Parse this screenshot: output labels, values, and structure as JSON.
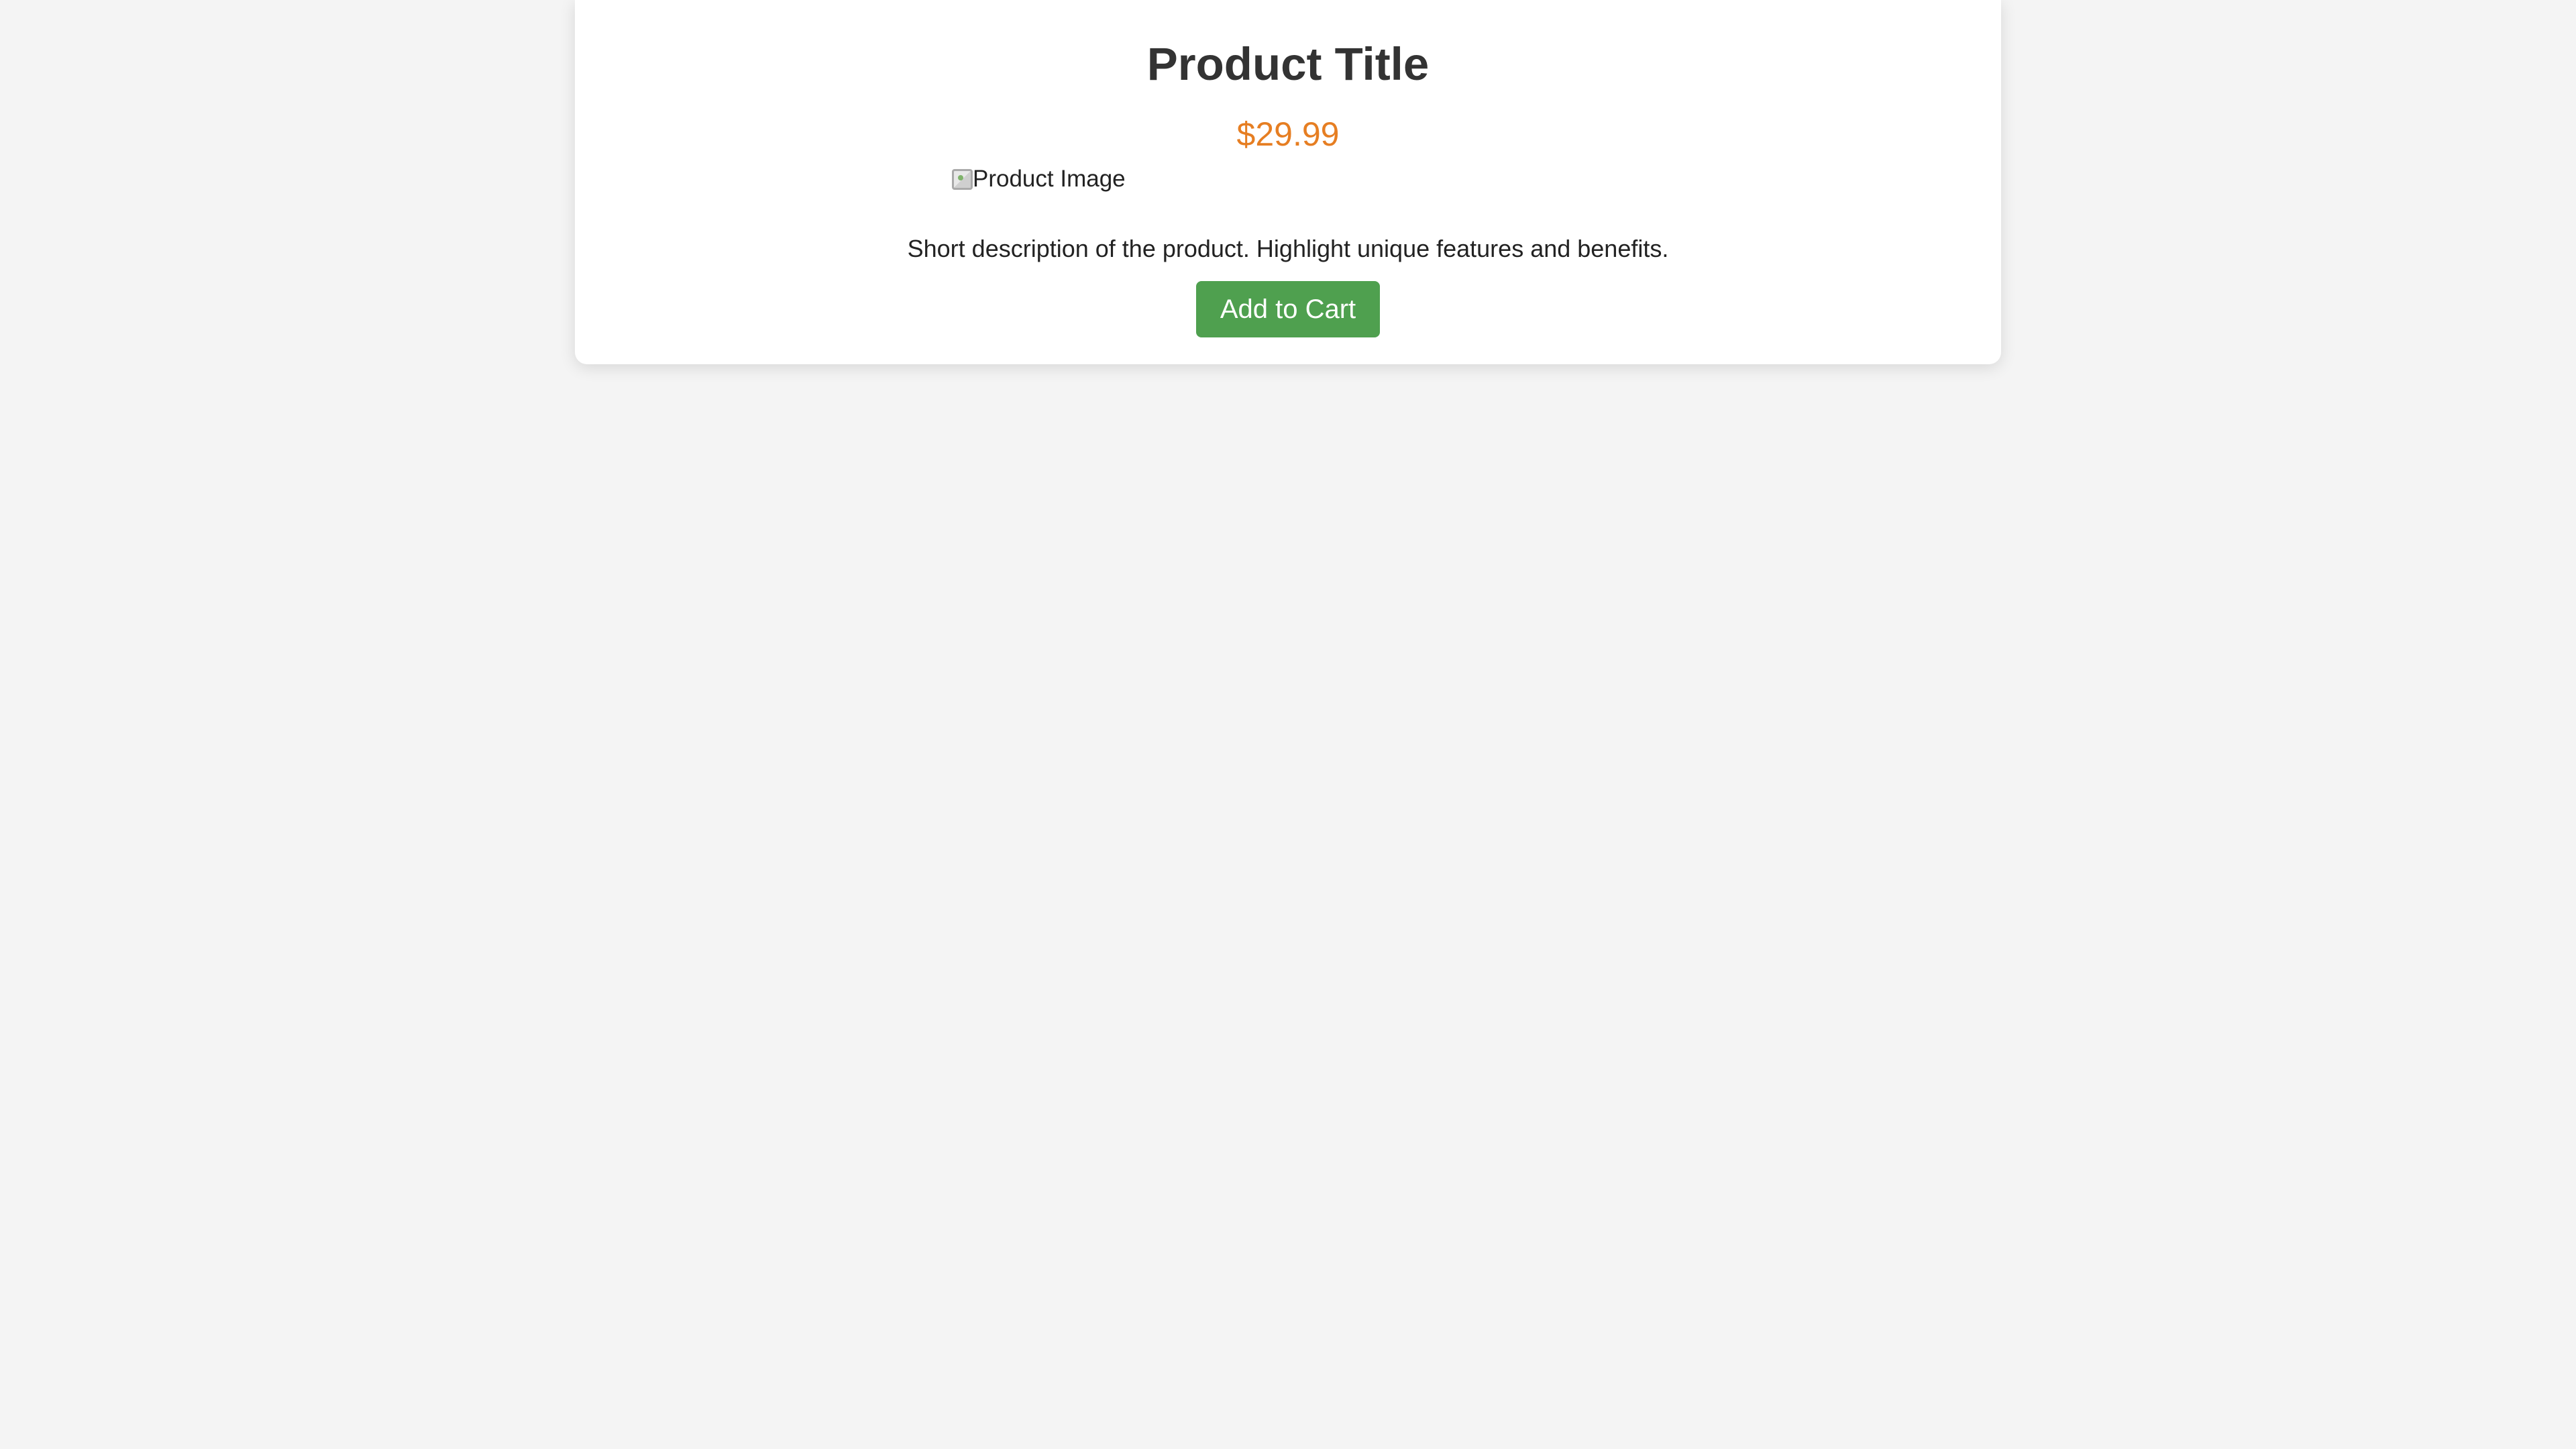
{
  "product": {
    "title": "Product Title",
    "price": "$29.99",
    "image_alt": "Product Image",
    "description": "Short description of the product. Highlight unique features and benefits.",
    "add_to_cart_label": "Add to Cart"
  },
  "colors": {
    "page_background": "#f4f4f4",
    "card_background": "#ffffff",
    "title": "#333333",
    "price_accent": "#e67e22",
    "button_background": "#4fa04f",
    "button_text": "#ffffff"
  },
  "icons": {
    "product_image": "broken-image-icon"
  }
}
